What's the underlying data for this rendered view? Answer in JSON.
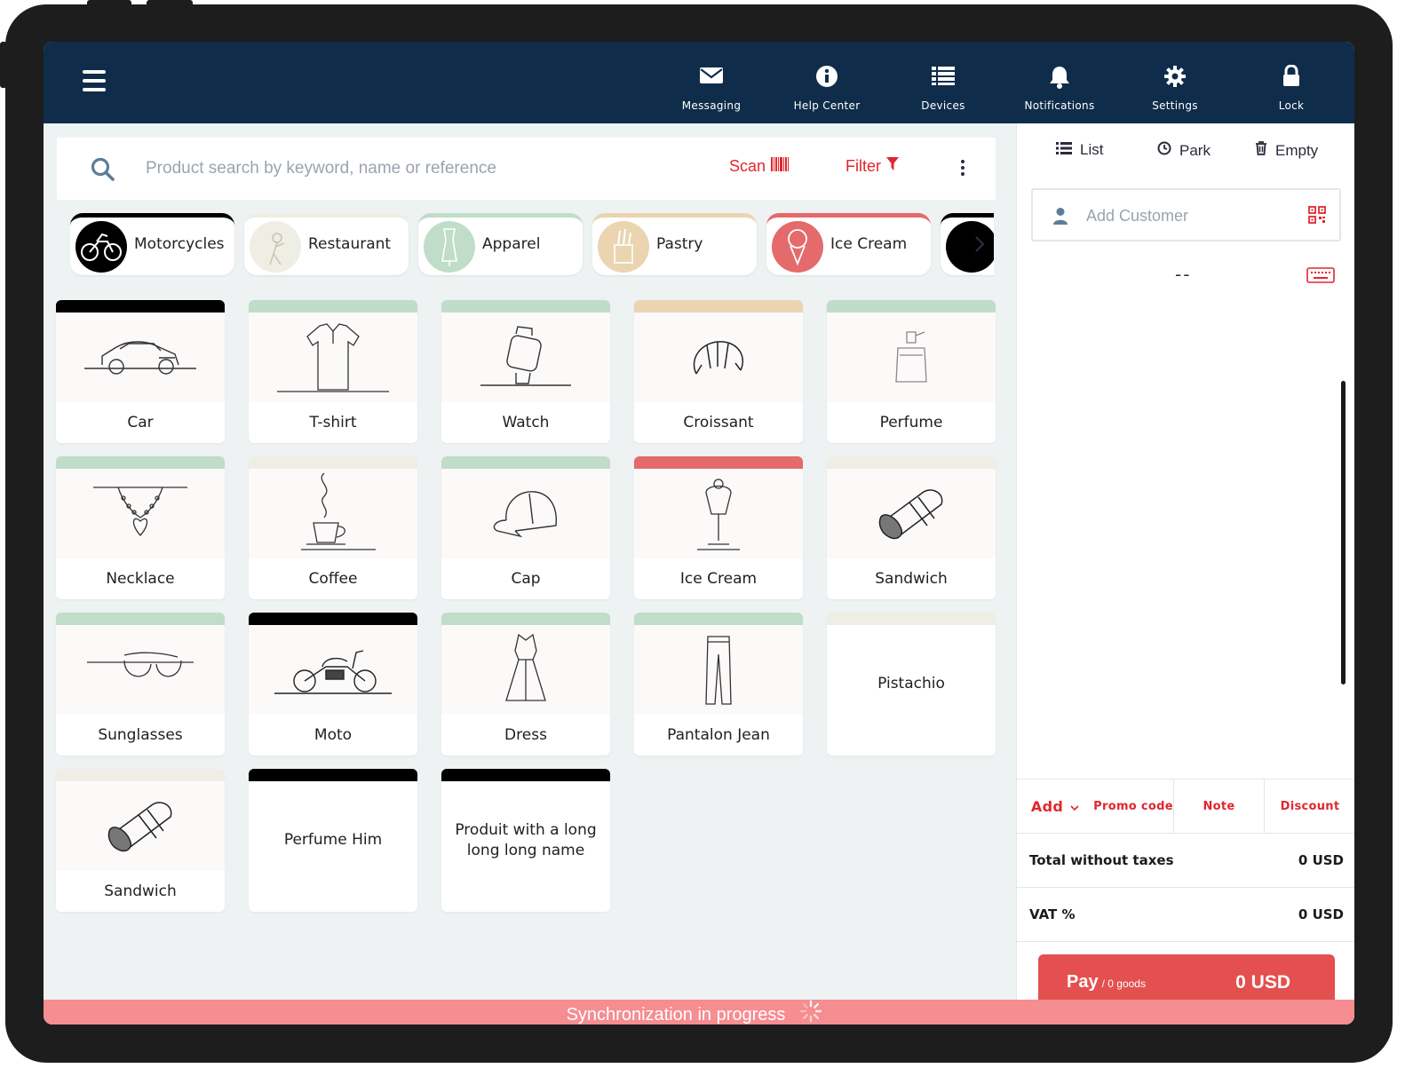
{
  "topbar": {
    "nav": [
      {
        "label": "Messaging",
        "icon": "envelope-icon"
      },
      {
        "label": "Help Center",
        "icon": "info-icon"
      },
      {
        "label": "Devices",
        "icon": "list-icon"
      },
      {
        "label": "Notifications",
        "icon": "bell-icon"
      },
      {
        "label": "Settings",
        "icon": "gear-icon"
      },
      {
        "label": "Lock",
        "icon": "lock-icon"
      }
    ]
  },
  "search": {
    "placeholder": "Product search by keyword, name or reference",
    "scan_label": "Scan",
    "filter_label": "Filter"
  },
  "categories": [
    {
      "label": "Motorcycles",
      "color": "#000000"
    },
    {
      "label": "Restaurant",
      "color": "#eeeee4"
    },
    {
      "label": "Apparel",
      "color": "#bfddc9"
    },
    {
      "label": "Pastry",
      "color": "#ead5b0"
    },
    {
      "label": "Ice Cream",
      "color": "#e46a6c"
    }
  ],
  "products": [
    {
      "name": "Car",
      "color": "#000000",
      "icon": "car-icon"
    },
    {
      "name": "T-shirt",
      "color": "#bfddc9",
      "icon": "tshirt-icon"
    },
    {
      "name": "Watch",
      "color": "#bfddc9",
      "icon": "watch-icon"
    },
    {
      "name": "Croissant",
      "color": "#ead5b0",
      "icon": "croissant-icon"
    },
    {
      "name": "Perfume",
      "color": "#bfddc9",
      "icon": "perfume-icon"
    },
    {
      "name": "Necklace",
      "color": "#bfddc9",
      "icon": "necklace-icon"
    },
    {
      "name": "Coffee",
      "color": "#eeeee4",
      "icon": "coffee-icon"
    },
    {
      "name": "Cap",
      "color": "#bfddc9",
      "icon": "cap-icon"
    },
    {
      "name": "Ice Cream",
      "color": "#e46a6c",
      "icon": "ice-cream-icon"
    },
    {
      "name": "Sandwich",
      "color": "#eeeee4",
      "icon": "sandwich-icon"
    },
    {
      "name": "Sunglasses",
      "color": "#bfddc9",
      "icon": "sunglasses-icon"
    },
    {
      "name": "Moto",
      "color": "#000000",
      "icon": "motorcycle-icon"
    },
    {
      "name": "Dress",
      "color": "#bfddc9",
      "icon": "dress-icon"
    },
    {
      "name": "Pantalon Jean",
      "color": "#bfddc9",
      "icon": "jeans-icon"
    },
    {
      "name": "Pistachio",
      "color": "#eeeee4",
      "icon": ""
    },
    {
      "name": "Sandwich",
      "color": "#eeeee4",
      "icon": "sandwich-icon"
    },
    {
      "name": "Perfume Him",
      "color": "#000000",
      "icon": ""
    },
    {
      "name": "Produit with a long long long name",
      "color": "#000000",
      "icon": ""
    }
  ],
  "cart": {
    "list_label": "List",
    "park_label": "Park",
    "empty_label": "Empty",
    "customer_placeholder": "Add Customer",
    "dash_value": "--",
    "add_label": "Add",
    "promo_label": "Promo code",
    "note_label": "Note",
    "discount_label": "Discount",
    "total_label": "Total without taxes",
    "total_value": "0 USD",
    "vat_label": "VAT %",
    "vat_value": "0 USD",
    "pay_label": "Pay",
    "pay_goods": "/ 0 goods",
    "pay_amount": "0 USD"
  },
  "status": {
    "sync_text": "Synchronization in progress"
  },
  "colors": {
    "topbar": "#0f2d4a",
    "accent": "#e0272e",
    "pay": "#e3504f",
    "sync_bar": "#f58d91"
  }
}
